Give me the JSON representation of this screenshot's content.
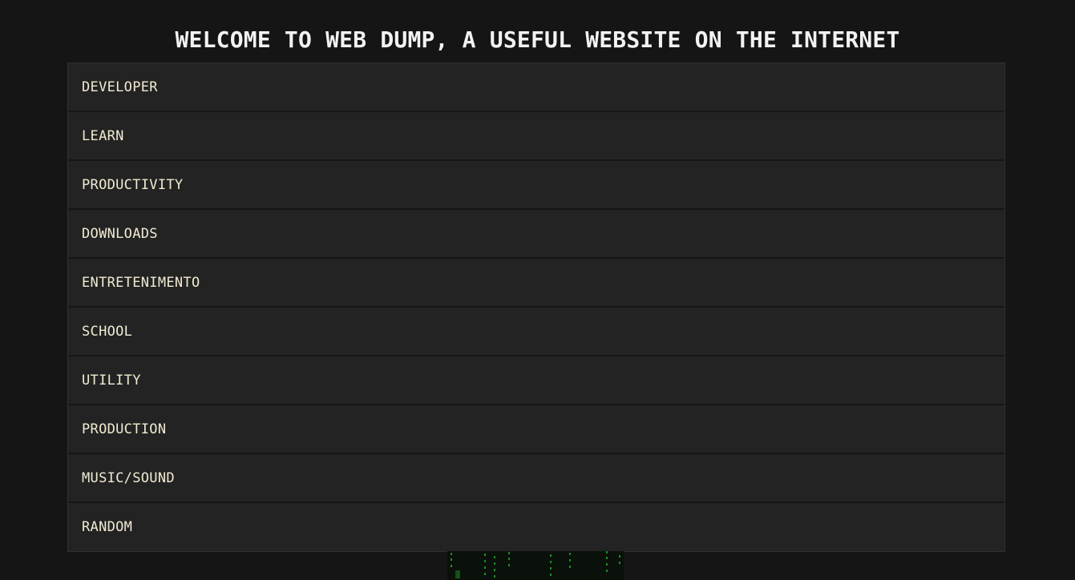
{
  "header": {
    "title": "WELCOME TO WEB DUMP, A USEFUL WEBSITE ON THE INTERNET"
  },
  "categories": [
    {
      "label": "DEVELOPER"
    },
    {
      "label": "LEARN"
    },
    {
      "label": "PRODUCTIVITY"
    },
    {
      "label": "DOWNLOADS"
    },
    {
      "label": "ENTRETENIMENTO"
    },
    {
      "label": "SCHOOL"
    },
    {
      "label": "UTILITY"
    },
    {
      "label": "PRODUCTION"
    },
    {
      "label": "MUSIC/SOUND"
    },
    {
      "label": "RANDOM"
    }
  ],
  "colors": {
    "background": "#151515",
    "panel": "#232323",
    "title_text": "#f2f2f2",
    "item_text": "#f1ead2",
    "matrix_green": "#1f8a2a"
  }
}
